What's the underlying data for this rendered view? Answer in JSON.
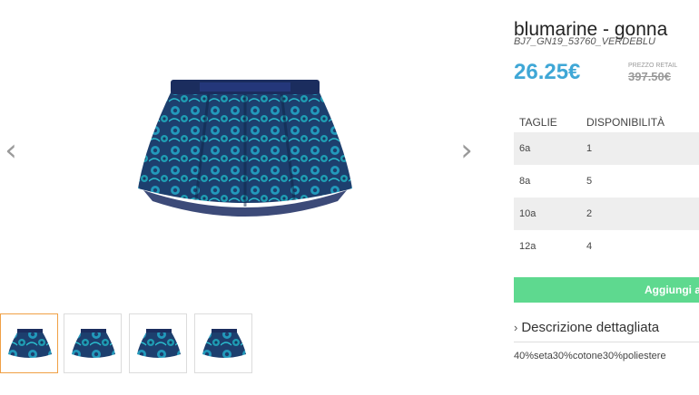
{
  "product": {
    "title": "blumarine - gonna",
    "sku": "BJ7_GN19_53760_VERDEBLU",
    "price": "26.25€",
    "retail_label": "PREZZO RETAIL",
    "retail_price": "397.50€"
  },
  "sizes": {
    "header_size": "TAGLIE",
    "header_availability": "DISPONIBILITÀ",
    "rows": [
      {
        "size": "6a",
        "qty": "1"
      },
      {
        "size": "8a",
        "qty": "5"
      },
      {
        "size": "10a",
        "qty": "2"
      },
      {
        "size": "12a",
        "qty": "4"
      }
    ]
  },
  "actions": {
    "add_to_cart": "Aggiungi al c"
  },
  "description": {
    "toggle_label": "Descrizione dettagliata",
    "composition": "40%seta30%cotone30%poliestere"
  },
  "gallery": {
    "prev_icon": "chevron-left-icon",
    "next_icon": "chevron-right-icon",
    "thumbnail_count": 4,
    "active_thumbnail": 1
  },
  "colors": {
    "price": "#3fa7d6",
    "add_button": "#5ed98f",
    "active_thumb_border": "#f0a045",
    "skirt_dark": "#1a2f5c",
    "skirt_teal": "#22a6c8"
  }
}
